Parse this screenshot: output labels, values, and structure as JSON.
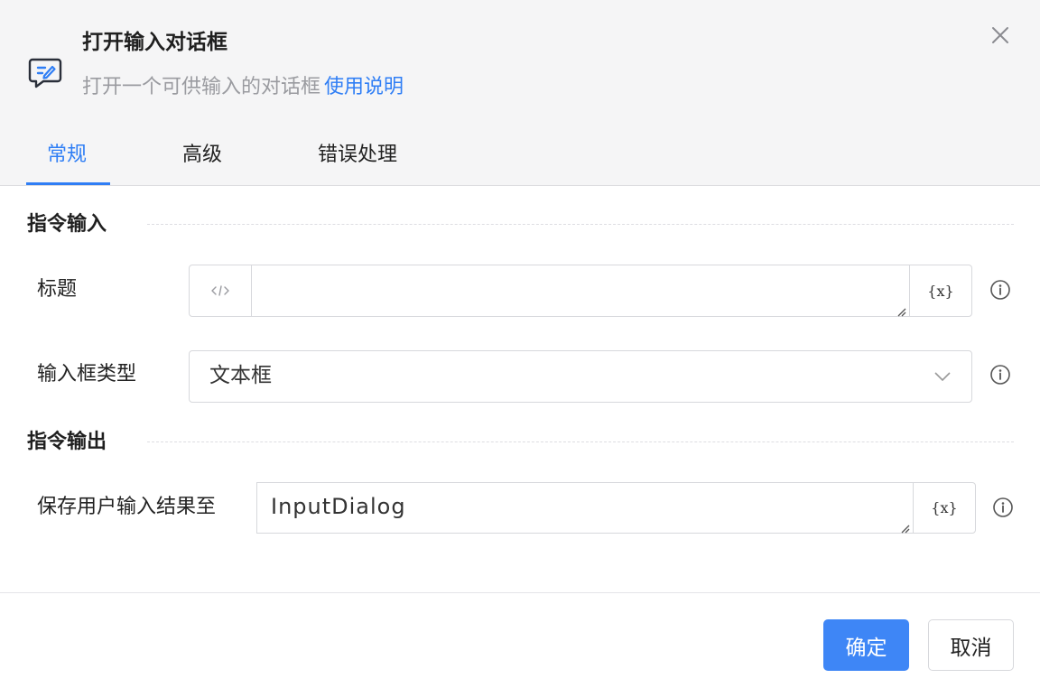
{
  "header": {
    "title": "打开输入对话框",
    "subtitle": "打开一个可供输入的对话框",
    "help_link": "使用说明",
    "icon": "chat-edit-icon",
    "close_icon": "close-icon"
  },
  "tabs": [
    {
      "label": "常规",
      "active": true
    },
    {
      "label": "高级",
      "active": false
    },
    {
      "label": "错误处理",
      "active": false
    }
  ],
  "sections": {
    "input": {
      "title": "指令输入",
      "fields": {
        "title_field": {
          "label": "标题",
          "value": "",
          "prefix_icon": "code-icon",
          "var_button": "{x}"
        },
        "input_type": {
          "label": "输入框类型",
          "value": "文本框"
        }
      }
    },
    "output": {
      "title": "指令输出",
      "fields": {
        "save_to": {
          "label": "保存用户输入结果至",
          "value": "InputDialog",
          "var_button": "{x}"
        }
      }
    }
  },
  "footer": {
    "ok_label": "确定",
    "cancel_label": "取消"
  },
  "colors": {
    "accent": "#2f7ef5",
    "primary_button": "#3e86f6",
    "header_bg": "#f5f5f6"
  }
}
